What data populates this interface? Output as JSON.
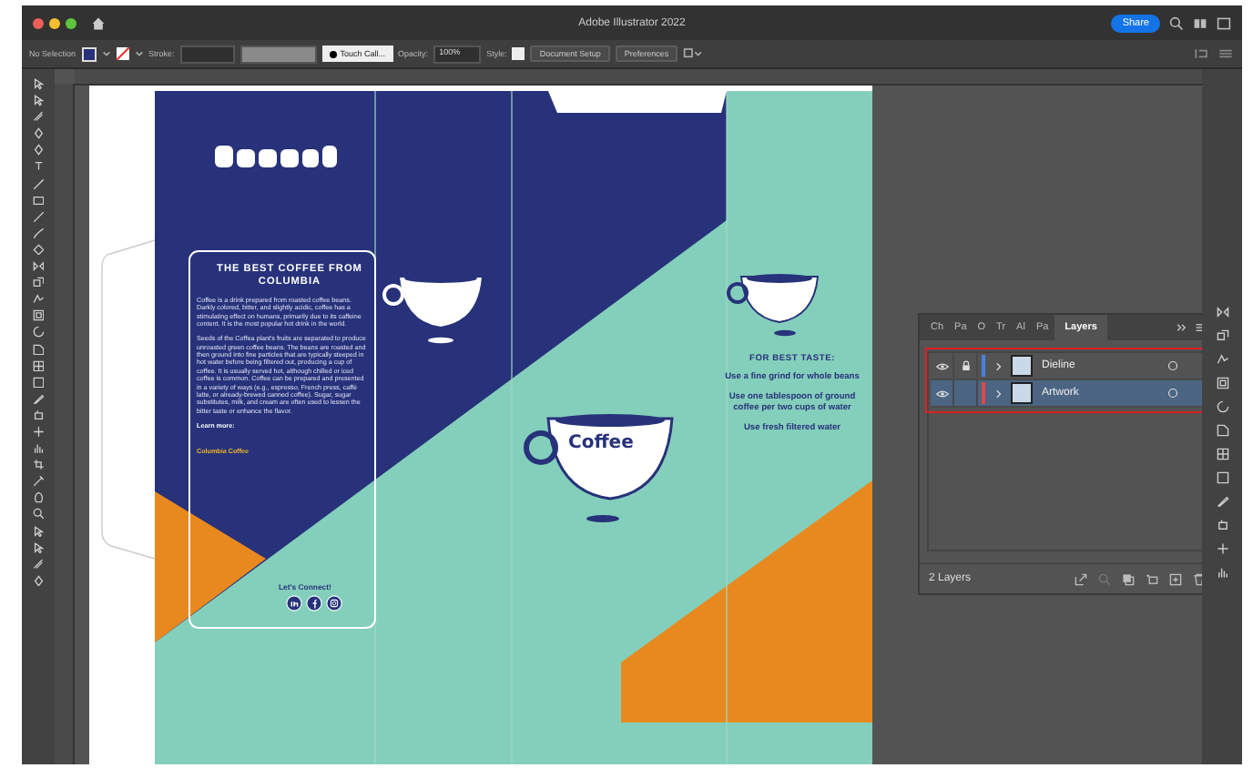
{
  "window": {
    "title": "Adobe Illustrator 2022",
    "share": "Share"
  },
  "control_bar": {
    "selection": "No Selection",
    "stroke_label": "Stroke:",
    "brush": "Touch Call...",
    "opacity_label": "Opacity:",
    "opacity": "100%",
    "style_label": "Style:",
    "buttons": [
      "Document Setup",
      "Preferences"
    ]
  },
  "artwork": {
    "heading": "THE BEST COFFEE FROM COLUMBIA",
    "paragraphs": [
      "Coffee is a drink prepared from roasted coffee beans. Darkly colored, bitter, and slightly acidic, coffee has a stimulating effect on humans, primarily due to its caffeine content. It is the most popular hot drink in the world.",
      "Seeds of the Coffea plant's fruits are separated to produce unroasted green coffee beans. The beans are roasted and then ground into fine particles that are typically steeped in hot water before being filtered out, producing a cup of coffee. It is usually served hot, although chilled or iced coffee is common. Coffee can be prepared and presented in a variety of ways (e.g., espresso, French press, caffè latte, or already-brewed canned coffee). Sugar, sugar substitutes, milk, and cream are often used to lessen the bitter taste or enhance the flavor."
    ],
    "learn_more": "Learn more:",
    "link": "Columbia Coffee",
    "connect": "Let's Connect!",
    "cup_label": "Coffee",
    "tips_heading": "FOR BEST TASTE:",
    "tips": [
      "Use a fine grind for whole beans",
      "Use one tablespoon of ground coffee per two cups of water",
      "Use fresh filtered water"
    ]
  },
  "layers_panel": {
    "tabs": [
      {
        "label": "Ch",
        "selected": false
      },
      {
        "label": "Pa",
        "selected": false
      },
      {
        "label": "O",
        "selected": false
      },
      {
        "label": "Tr",
        "selected": false
      },
      {
        "label": "Al",
        "selected": false
      },
      {
        "label": "Pa",
        "selected": false
      },
      {
        "label": "Layers",
        "selected": true
      }
    ],
    "layers": [
      {
        "name": "Dieline",
        "visible": true,
        "locked": true,
        "color": "#4a7fe0",
        "selected": false
      },
      {
        "name": "Artwork",
        "visible": true,
        "locked": false,
        "color": "#e04848",
        "selected": true
      }
    ],
    "count": "2 Layers"
  }
}
